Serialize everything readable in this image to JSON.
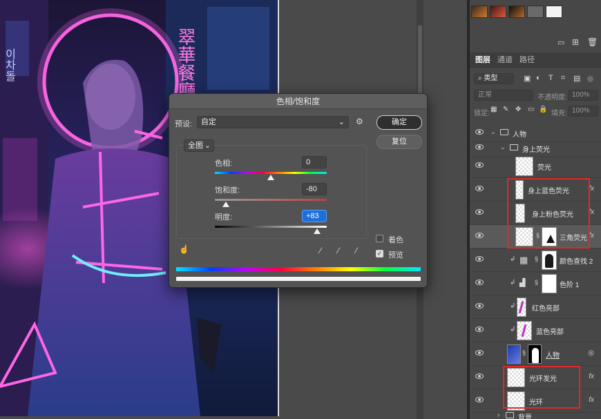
{
  "dialog": {
    "title": "色相/饱和度",
    "preset_label": "预设:",
    "preset_value": "自定",
    "range_value": "全图",
    "ok_label": "确定",
    "reset_label": "复位",
    "hue_label": "色相:",
    "hue_value": "0",
    "saturation_label": "饱和度:",
    "saturation_value": "-80",
    "lightness_label": "明度:",
    "lightness_value": "+83",
    "colorize_label": "着色",
    "preview_label": "预览",
    "colorize_checked": false,
    "preview_checked": true,
    "hue_level": 0,
    "saturation_level": -80,
    "lightness_level": 83
  },
  "layers_panel": {
    "tabs": [
      "图层",
      "通道",
      "路径"
    ],
    "filter_kind": "类型",
    "blend_mode": "正常",
    "opacity_label": "不透明度:",
    "opacity_value": "100%",
    "lock_label": "锁定:",
    "fill_label": "填充:",
    "fill_value": "100%",
    "layers": [
      {
        "name": "人物",
        "kind": "group"
      },
      {
        "name": "身上荧光",
        "kind": "group"
      },
      {
        "name": "荧光",
        "kind": "layer"
      },
      {
        "name": "身上蓝色荧光",
        "kind": "layer",
        "fx": "fx"
      },
      {
        "name": "身上粉色荧光",
        "kind": "layer",
        "fx": "fx"
      },
      {
        "name": "三角荧光",
        "kind": "layer",
        "fx": "fx"
      },
      {
        "name": "颜色查找 2",
        "kind": "adjustment"
      },
      {
        "name": "色阶 1",
        "kind": "adjustment"
      },
      {
        "name": "红色亮部",
        "kind": "layer"
      },
      {
        "name": "蓝色亮部",
        "kind": "layer"
      },
      {
        "name": "人物",
        "kind": "smart"
      },
      {
        "name": "光环发光",
        "kind": "layer",
        "fx": "fx"
      },
      {
        "name": "光环",
        "kind": "layer",
        "fx": "fx"
      },
      {
        "name": "背景",
        "kind": "group"
      }
    ]
  },
  "artwork": {
    "sign_text": "翠華餐廳",
    "korean_text": "이차돌"
  },
  "colors": {
    "accent_blue": "#1e6fd9",
    "highlight_red": "#e02a2a",
    "neon_pink": "#ff4fd8",
    "neon_cyan": "#5fe6ff"
  }
}
